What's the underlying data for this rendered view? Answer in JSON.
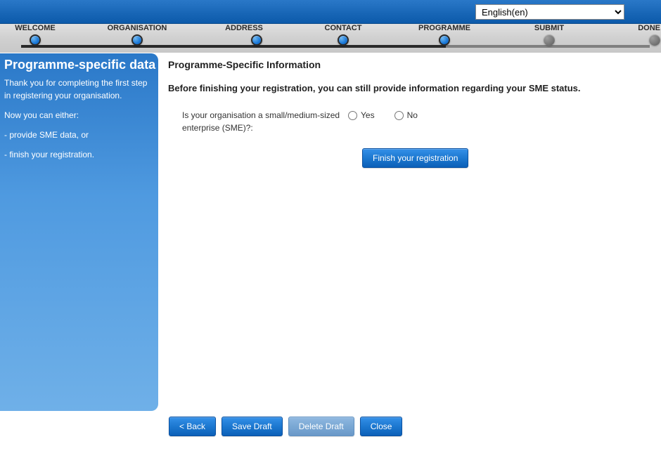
{
  "header": {
    "language_selected": "English(en)"
  },
  "stepper": {
    "steps": [
      {
        "label": "WELCOME",
        "active": true
      },
      {
        "label": "ORGANISATION",
        "active": true
      },
      {
        "label": "ADDRESS",
        "active": true
      },
      {
        "label": "CONTACT",
        "active": true
      },
      {
        "label": "PROGRAMME",
        "active": true
      },
      {
        "label": "SUBMIT",
        "active": false
      },
      {
        "label": "DONE",
        "active": false
      }
    ]
  },
  "sidebar": {
    "title": "Programme-specific data",
    "text1": "Thank you for completing the first step in registering your organisation.",
    "text2": "Now you can either:",
    "text3": "- provide SME data, or",
    "text4": "- finish your registration."
  },
  "content": {
    "title": "Programme-Specific Information",
    "subtitle": "Before finishing your registration, you can still provide information regarding your SME status.",
    "sme_question": "Is your organisation a small/medium-sized enterprise (SME)?:",
    "option_yes": "Yes",
    "option_no": "No",
    "finish_button": "Finish your registration"
  },
  "footer": {
    "back": "< Back",
    "save_draft": "Save Draft",
    "delete_draft": "Delete Draft",
    "close": "Close"
  }
}
